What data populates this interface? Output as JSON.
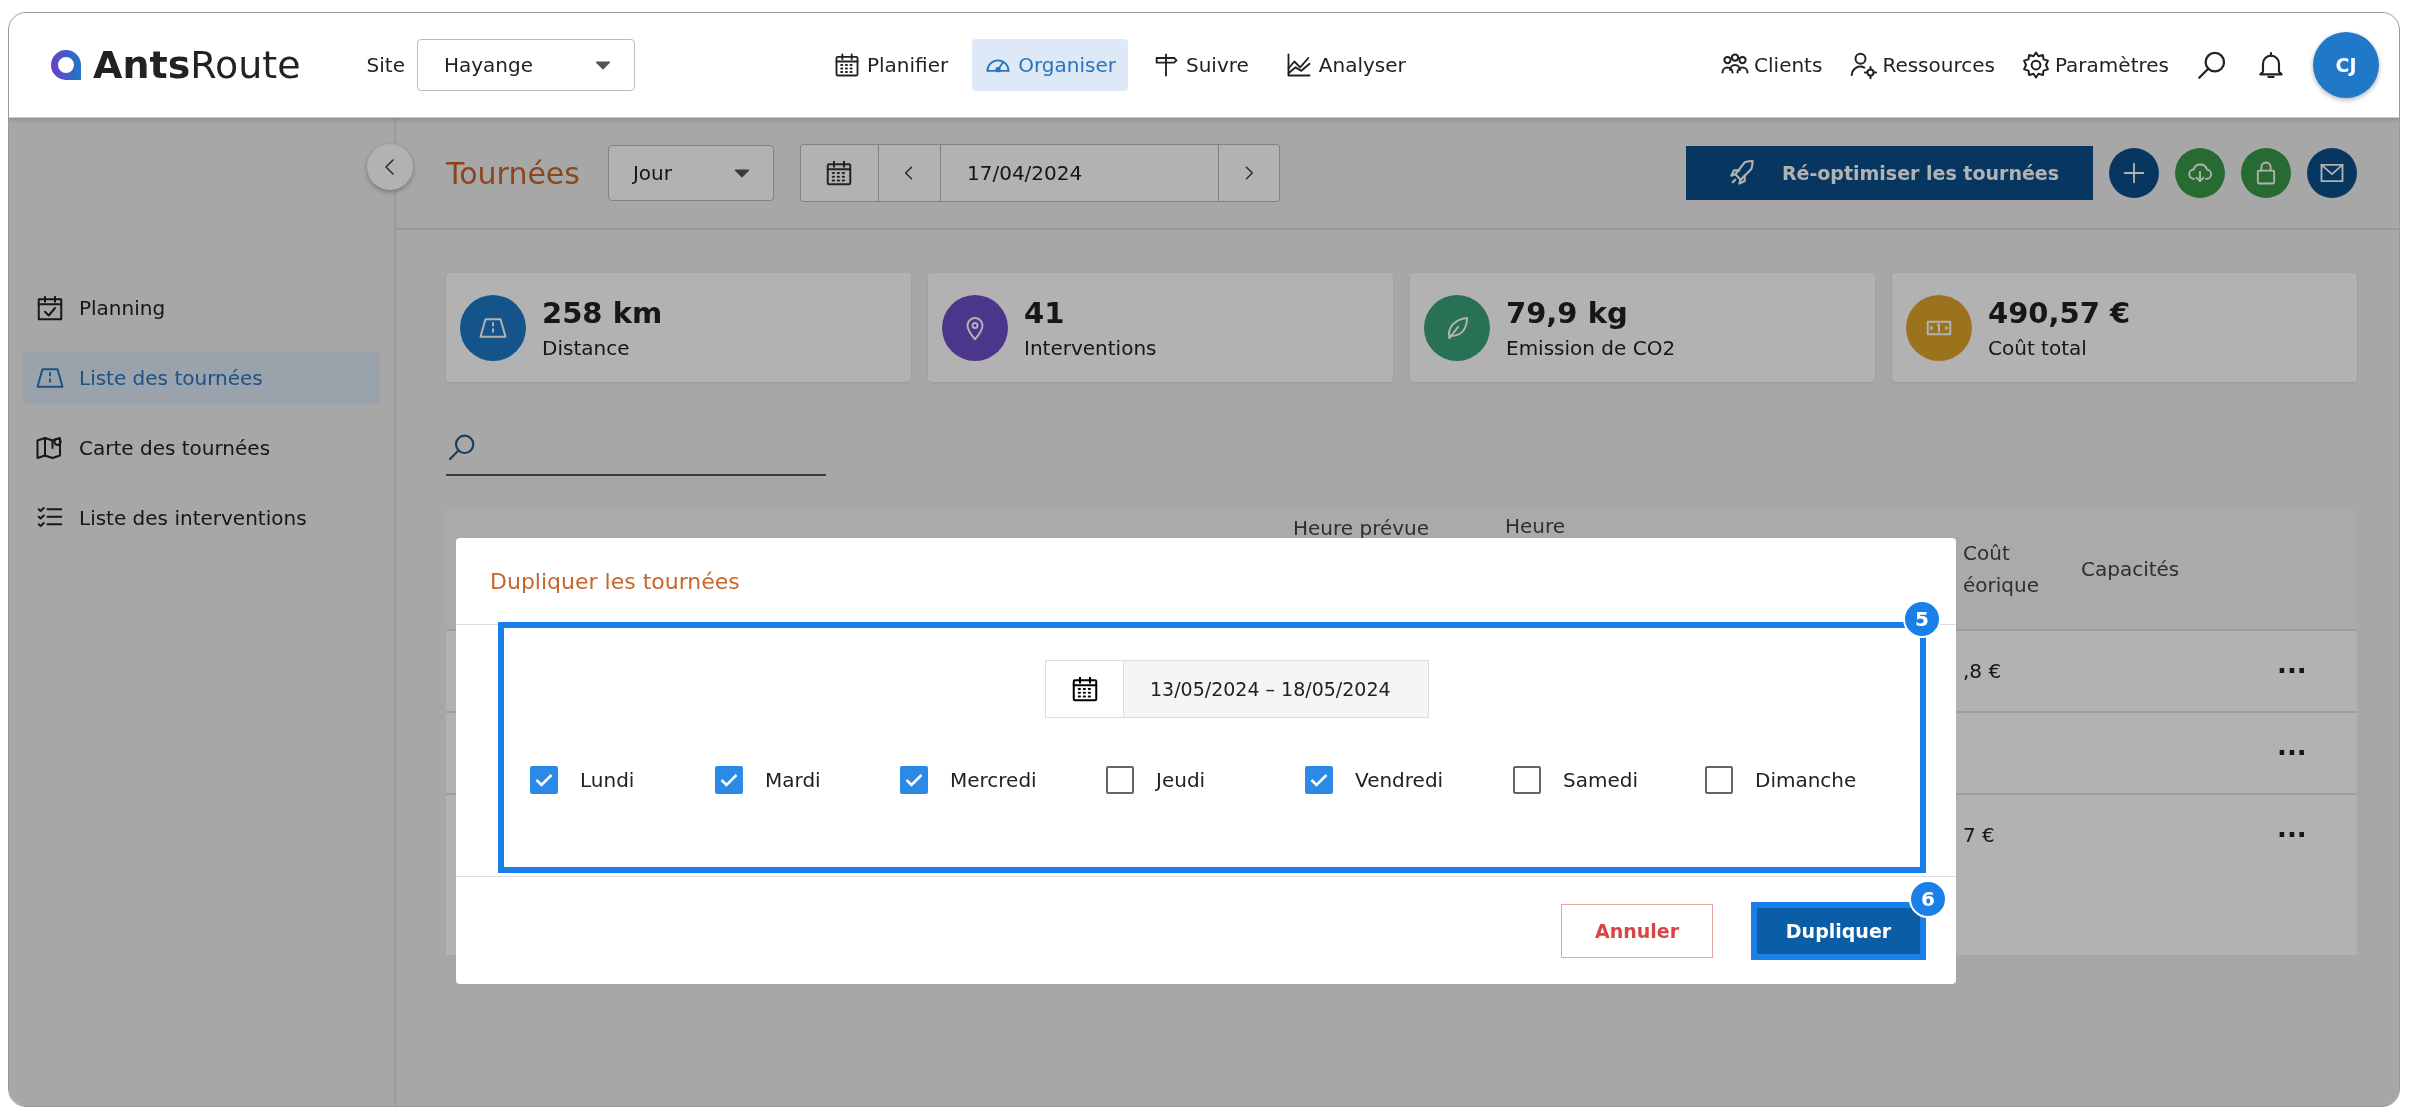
{
  "header": {
    "logo": "**Ants**Route",
    "site": {
      "label": "Site",
      "value": "Hayange"
    },
    "nav": [
      {
        "label": "Planifier",
        "selected": false
      },
      {
        "label": "Organiser",
        "selected": true
      },
      {
        "label": "Suivre",
        "selected": false
      },
      {
        "label": "Analyser",
        "selected": false
      }
    ],
    "tools": [
      {
        "label": "Clients"
      },
      {
        "label": "Ressources"
      },
      {
        "label": "Paramètres"
      }
    ],
    "avatar": "CJ"
  },
  "sidebar": {
    "items": [
      {
        "label": "Planning",
        "selected": false
      },
      {
        "label": "Liste des tournées",
        "selected": true
      },
      {
        "label": "Carte des tournées",
        "selected": false
      },
      {
        "label": "Liste des interventions",
        "selected": false
      }
    ]
  },
  "toolbar": {
    "title": "Tournées",
    "view": "Jour",
    "date": "17/04/2024",
    "primary_action": "Ré-optimiser les tournées"
  },
  "stats": [
    {
      "value": "258 km",
      "label": "Distance"
    },
    {
      "value": "41",
      "label": "Interventions"
    },
    {
      "value": "79,9 kg",
      "label": "Emission de CO2"
    },
    {
      "value": "490,57 €",
      "label": "Coût total"
    }
  ],
  "table": {
    "columns": [
      {
        "lines": [
          "Heure prévue"
        ]
      },
      {
        "lines": [
          "Heure"
        ]
      },
      {
        "lines": [
          "Coût",
          "éorique"
        ]
      },
      {
        "lines": [
          "Capacités"
        ]
      }
    ],
    "rows": [
      {
        "cost": ",8 €",
        "menu": "···"
      },
      {
        "menu": "···"
      },
      {
        "cost": "7 €",
        "menu": "···"
      }
    ]
  },
  "dialog": {
    "title": "Dupliquer les tournées",
    "date_range": "13/05/2024 – 18/05/2024",
    "days": [
      {
        "label": "Lundi",
        "checked": true
      },
      {
        "label": "Mardi",
        "checked": true
      },
      {
        "label": "Mercredi",
        "checked": true
      },
      {
        "label": "Jeudi",
        "checked": false
      },
      {
        "label": "Vendredi",
        "checked": true
      },
      {
        "label": "Samedi",
        "checked": false
      },
      {
        "label": "Dimanche",
        "checked": false
      }
    ],
    "cancel": "Annuler",
    "confirm": "Dupliquer",
    "step_markers": [
      {
        "label": "5"
      },
      {
        "label": "6"
      }
    ]
  }
}
